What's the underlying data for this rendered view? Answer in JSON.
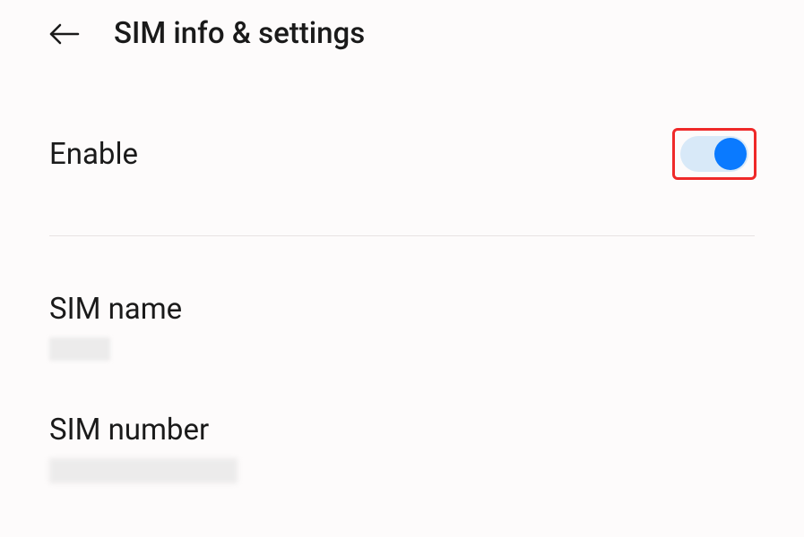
{
  "header": {
    "title": "SIM info & settings"
  },
  "enable": {
    "label": "Enable",
    "state": true
  },
  "sim_name": {
    "label": "SIM name",
    "value": ""
  },
  "sim_number": {
    "label": "SIM number",
    "value": ""
  },
  "colors": {
    "highlight": "#ef2929",
    "toggle_on": "#0a7aff",
    "toggle_track": "#d8e9f8"
  }
}
